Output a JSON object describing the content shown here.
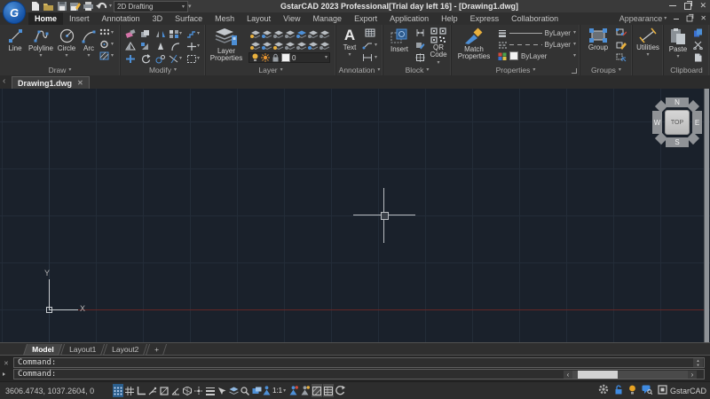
{
  "icons": {
    "logo": "G",
    "dropdown": "▾",
    "close": "✕",
    "chevron_left": "‹",
    "chevron_right": "›",
    "scroll_up": "▲",
    "scroll_down": "▼",
    "text_tool": "A"
  },
  "titlebar": {
    "title": "GstarCAD 2023 Professional[Trial day left 16] - [Drawing1.dwg]",
    "workspace": "2D Drafting"
  },
  "menu": {
    "tabs": [
      "Home",
      "Insert",
      "Annotation",
      "3D",
      "Surface",
      "Mesh",
      "Layout",
      "View",
      "Manage",
      "Export",
      "Application",
      "Help",
      "Express",
      "Collaboration"
    ],
    "appearance": "Appearance"
  },
  "ribbon": {
    "draw": {
      "label": "Draw",
      "line": "Line",
      "polyline": "Polyline",
      "circle": "Circle",
      "arc": "Arc"
    },
    "modify": {
      "label": "Modify"
    },
    "layer": {
      "label": "Layer",
      "properties_button": "Layer Properties",
      "current_layer": "0"
    },
    "annotation": {
      "label": "Annotation",
      "text_button": "Text"
    },
    "block": {
      "label": "Block",
      "insert_button": "Insert",
      "qr_button": "QR Code"
    },
    "properties": {
      "label": "Properties",
      "match_button": "Match Properties",
      "lineweight_value": "ByLayer",
      "linetype_value": "ByLayer",
      "color_value": "ByLayer"
    },
    "groups": {
      "label": "Groups",
      "group_button": "Group"
    },
    "utilities": {
      "label": "Utilities"
    },
    "clipboard": {
      "label": "Clipboard",
      "paste_button": "Paste"
    }
  },
  "document_tab": {
    "name": "Drawing1.dwg"
  },
  "canvas": {
    "viewcube": {
      "n": "N",
      "e": "E",
      "s": "S",
      "w": "W",
      "top": "TOP"
    },
    "ucs": {
      "x": "X",
      "y": "Y"
    }
  },
  "layout_tabs": {
    "model": "Model",
    "layout1": "Layout1",
    "layout2": "Layout2",
    "add": "+"
  },
  "command": {
    "line1": "Command:",
    "line2": "Command:"
  },
  "status": {
    "coordinates": "3606.4743, 1037.2604, 0",
    "scale": "1:1",
    "brand": "GstarCAD"
  },
  "colors": {
    "accent_blue": "#4d8fd6",
    "canvas_bg": "#1a212b",
    "grid_line": "#232c38",
    "axis_red": "#642626",
    "highlight_yellow": "#e8b03d"
  }
}
